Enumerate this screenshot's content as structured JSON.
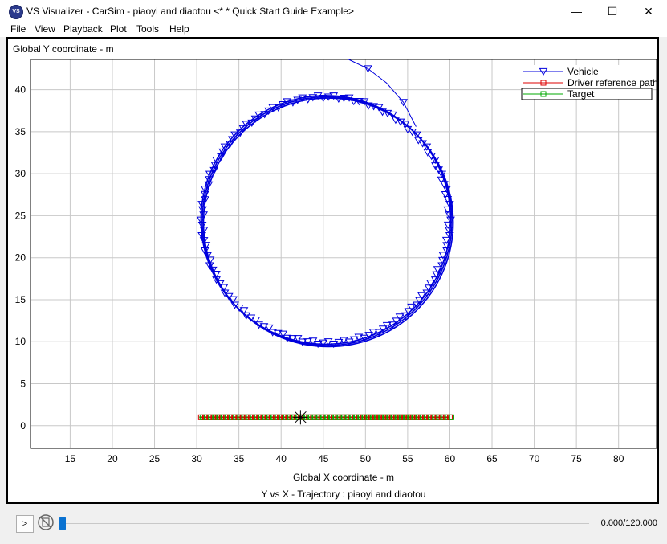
{
  "window": {
    "title": "VS Visualizer - CarSim - piaoyi and diaotou <* * Quick Start Guide Example>",
    "app_icon_text": "VS",
    "minimize_glyph": "—",
    "maximize_glyph": "☐",
    "close_glyph": "✕"
  },
  "menu": [
    "File",
    "View",
    "Playback",
    "Plot",
    "Tools",
    "Help"
  ],
  "plot": {
    "y_axis_title": "Global Y coordinate - m",
    "x_axis_title": "Global X coordinate - m",
    "plot_title": "Y vs X - Trajectory : piaoyi and diaotou"
  },
  "chart_data": {
    "type": "line",
    "xlim": [
      10.3,
      84.5
    ],
    "ylim": [
      -2.7,
      43.6
    ],
    "x_ticks": [
      15,
      20,
      25,
      30,
      35,
      40,
      45,
      50,
      55,
      60,
      65,
      70,
      75,
      80
    ],
    "y_ticks": [
      0,
      5,
      10,
      15,
      20,
      25,
      30,
      35,
      40
    ],
    "grid": true,
    "legend_position": "top-right",
    "legend": [
      "Vehicle",
      "Driver reference path",
      "Target"
    ],
    "series": [
      {
        "name": "Vehicle",
        "color": "#0000dd",
        "marker": "triangle-down",
        "circle": {
          "center": [
            45.3,
            24.5
          ],
          "radius_x": 14.8,
          "radius_y": 14.8
        },
        "exit_path": {
          "x": [
            56.0,
            54.5,
            52.5,
            50.3,
            48.0
          ],
          "y": [
            35.6,
            38.5,
            40.8,
            42.5,
            43.6
          ]
        }
      },
      {
        "name": "Driver reference path",
        "color": "#dd0000",
        "marker": "square",
        "x": [
          30.5,
          60.0
        ],
        "y": [
          1.0,
          1.0
        ]
      },
      {
        "name": "Target",
        "color": "#00aa00",
        "marker": "square",
        "x": [
          30.3,
          60.0
        ],
        "y": [
          1.0,
          1.0
        ]
      }
    ],
    "target_point": {
      "x": 42.3,
      "y": 1.0
    }
  },
  "playback": {
    "play_label": ">",
    "time_readout": "0.000/120.000",
    "progress_fraction": 0.0
  },
  "icons": {
    "record": "record-disabled-icon"
  }
}
